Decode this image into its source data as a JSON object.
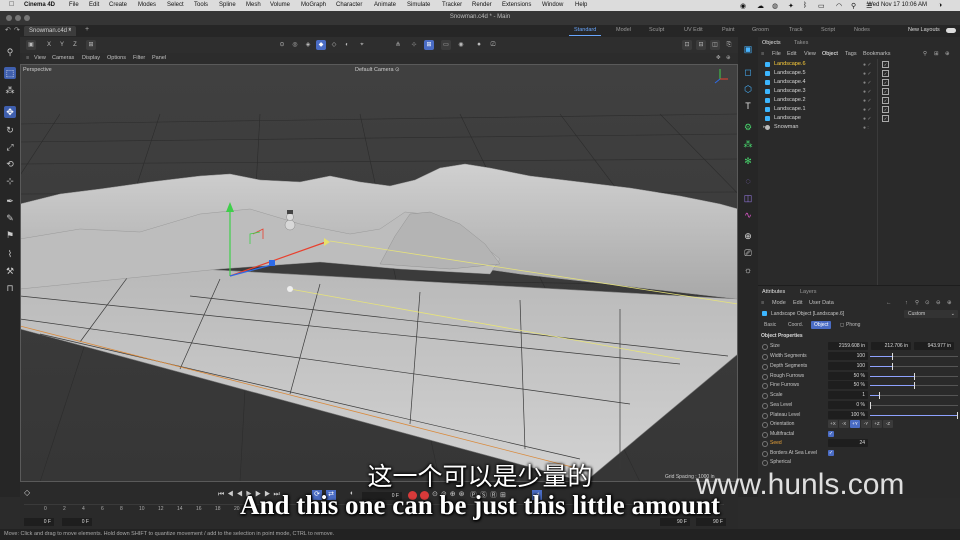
{
  "menubar": {
    "app_name": "Cinema 4D",
    "items": [
      "File",
      "Edit",
      "Create",
      "Modes",
      "Select",
      "Tools",
      "Spline",
      "Mesh",
      "Volume",
      "MoGraph",
      "Character",
      "Animate",
      "Simulate",
      "Tracker",
      "Render",
      "Extensions",
      "Window",
      "Help"
    ],
    "clock": "Wed Nov 17  10:06 AM"
  },
  "window": {
    "title": "Snowman.c4d * - Main",
    "doc_tab": "Snowman.c4d *"
  },
  "layouts": {
    "tabs": [
      "Standard",
      "Model",
      "Sculpt",
      "UV Edit",
      "Paint",
      "Groom",
      "Track",
      "Script",
      "Nodes"
    ],
    "active": "Standard",
    "new_layouts": "New Layouts"
  },
  "viewport": {
    "menu": [
      "View",
      "Cameras",
      "Display",
      "Options",
      "Filter",
      "Panel"
    ],
    "name": "Perspective",
    "camera": "Default Camera ⊙",
    "grid_spacing": "Grid Spacing : 1000 in"
  },
  "objects_panel": {
    "tabs": [
      "Objects",
      "Takes"
    ],
    "menu": [
      "File",
      "Edit",
      "View",
      "Object",
      "Tags",
      "Bookmarks"
    ],
    "active_menu": "Object",
    "items": [
      {
        "name": "Landscape.6",
        "selected": true
      },
      {
        "name": "Landscape.5",
        "selected": false
      },
      {
        "name": "Landscape.4",
        "selected": false
      },
      {
        "name": "Landscape.3",
        "selected": false
      },
      {
        "name": "Landscape.2",
        "selected": false
      },
      {
        "name": "Landscape.1",
        "selected": false
      },
      {
        "name": "Landscape",
        "selected": false
      },
      {
        "name": "Snowman",
        "selected": false
      }
    ]
  },
  "attributes_panel": {
    "tabs": [
      "Attributes",
      "Layers"
    ],
    "menu": [
      "Mode",
      "Edit",
      "User Data"
    ],
    "object_title": "Landscape Object [Landscape.6]",
    "preset": "Custom",
    "subtabs": [
      "Basic",
      "Coord.",
      "Object",
      "Phong"
    ],
    "active_subtab": "Object",
    "section": "Object Properties",
    "size": {
      "label": "Size",
      "x": "2159.608 in",
      "y": "212.706 in",
      "z": "943.977 in"
    },
    "rows": [
      {
        "label": "Width Segments",
        "value": "100",
        "slider": 0.25
      },
      {
        "label": "Depth Segments",
        "value": "100",
        "slider": 0.25
      },
      {
        "label": "Rough Furrows",
        "value": "50 %",
        "slider": 0.5
      },
      {
        "label": "Fine Furrows",
        "value": "50 %",
        "slider": 0.5
      },
      {
        "label": "Scale",
        "value": "1",
        "slider": 0.1
      },
      {
        "label": "Sea Level",
        "value": "0 %",
        "slider": 0.0
      },
      {
        "label": "Plateau Level",
        "value": "100 %",
        "slider": 1.0
      }
    ],
    "orientation": {
      "label": "Orientation",
      "options": [
        "+X",
        "-X",
        "+Y",
        "-Y",
        "+Z",
        "-Z"
      ],
      "selected": "+Y"
    },
    "multifractal": {
      "label": "Multifractal",
      "checked": true
    },
    "seed": {
      "label": "Seed",
      "value": "24"
    },
    "borders": {
      "label": "Borders At Sea Level",
      "checked": true
    },
    "spherical": {
      "label": "Spherical",
      "checked": false
    }
  },
  "timeline": {
    "ticks": [
      "0",
      "2",
      "4",
      "6",
      "8",
      "10",
      "12",
      "14",
      "16",
      "18",
      "20"
    ],
    "start_field": "0 F",
    "start_field2": "0 F",
    "current_frame": "0 F",
    "end_field": "90 F",
    "end_field2": "90 F"
  },
  "status": "Move: Click and drag to move elements. Hold down SHIFT to quantize movement / add to the selection in point mode, CTRL to remove.",
  "overlay": {
    "subtitle_zh": "这一个可以是少量的",
    "subtitle_en": "And this one can be just this little amount",
    "watermark": "www.hunls.com"
  },
  "colors": {
    "accent": "#4a6cc4",
    "selected_object": "#ffcf3a",
    "object_icon": "#3cb6ff",
    "axis_x": "#e8402e",
    "axis_y": "#3fcf4a",
    "axis_z": "#2e6be8"
  }
}
